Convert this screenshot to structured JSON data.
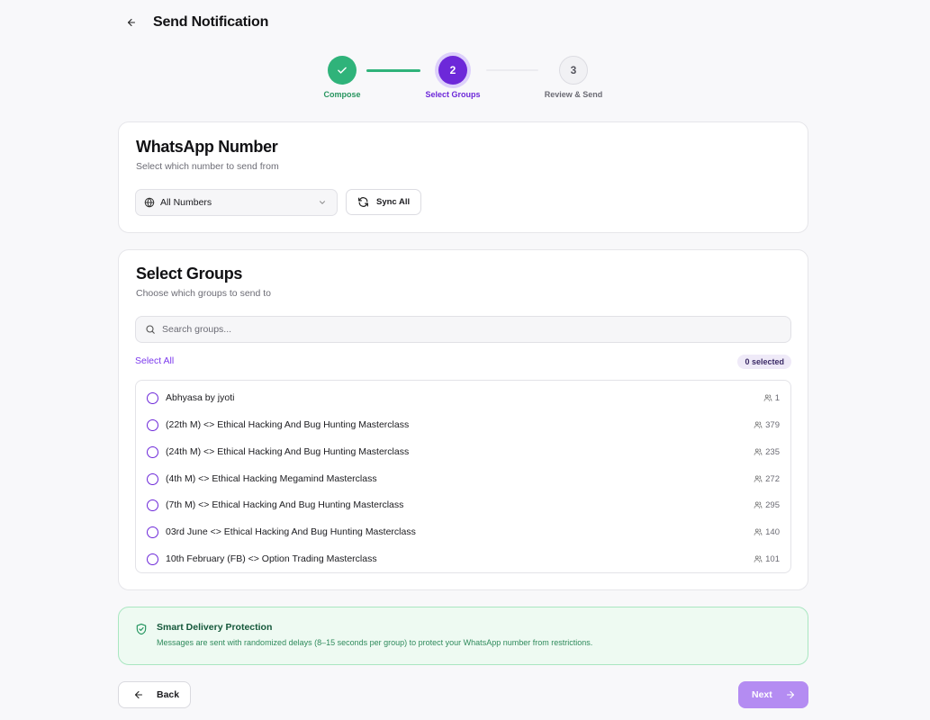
{
  "header": {
    "title": "Send Notification"
  },
  "stepper": {
    "steps": [
      {
        "label": "Compose",
        "number": "",
        "state": "complete"
      },
      {
        "label": "Select Groups",
        "number": "2",
        "state": "active"
      },
      {
        "label": "Review & Send",
        "number": "3",
        "state": "pending"
      }
    ]
  },
  "whatsapp": {
    "title": "WhatsApp Number",
    "subtitle": "Select which number to send from",
    "select_value": "All Numbers",
    "sync_label": "Sync All"
  },
  "groups": {
    "title": "Select Groups",
    "subtitle": "Choose which groups to send to",
    "search_placeholder": "Search groups...",
    "select_all_label": "Select All",
    "selected_badge": "0 selected",
    "items": [
      {
        "name": "Abhyasa by jyoti",
        "count": "1"
      },
      {
        "name": "(22th M) <> Ethical Hacking And Bug Hunting Masterclass",
        "count": "379"
      },
      {
        "name": "(24th M) <> Ethical Hacking And Bug Hunting Masterclass",
        "count": "235"
      },
      {
        "name": "(4th M) <> Ethical Hacking Megamind Masterclass",
        "count": "272"
      },
      {
        "name": "(7th M) <> Ethical Hacking And Bug Hunting Masterclass",
        "count": "295"
      },
      {
        "name": "03rd June <> Ethical Hacking And Bug Hunting Masterclass",
        "count": "140"
      },
      {
        "name": "10th February (FB) <> Option Trading Masterclass",
        "count": "101"
      }
    ]
  },
  "delivery": {
    "title": "Smart Delivery Protection",
    "text": "Messages are sent with randomized delays (8–15 seconds per group) to protect your WhatsApp number from restrictions."
  },
  "footer": {
    "back_label": "Back",
    "next_label": "Next"
  },
  "colors": {
    "primary": "#6d28d9",
    "success": "#2fb37a",
    "next_disabled": "#b48cf2",
    "info_bg": "#eefaf2"
  },
  "icons": {
    "back": "arrow-left-icon",
    "check": "check-icon",
    "globe": "globe-icon",
    "chevron": "chevron-down-icon",
    "sync": "refresh-icon",
    "search": "search-icon",
    "users": "users-icon",
    "shield": "shield-check-icon",
    "next": "arrow-right-icon"
  }
}
